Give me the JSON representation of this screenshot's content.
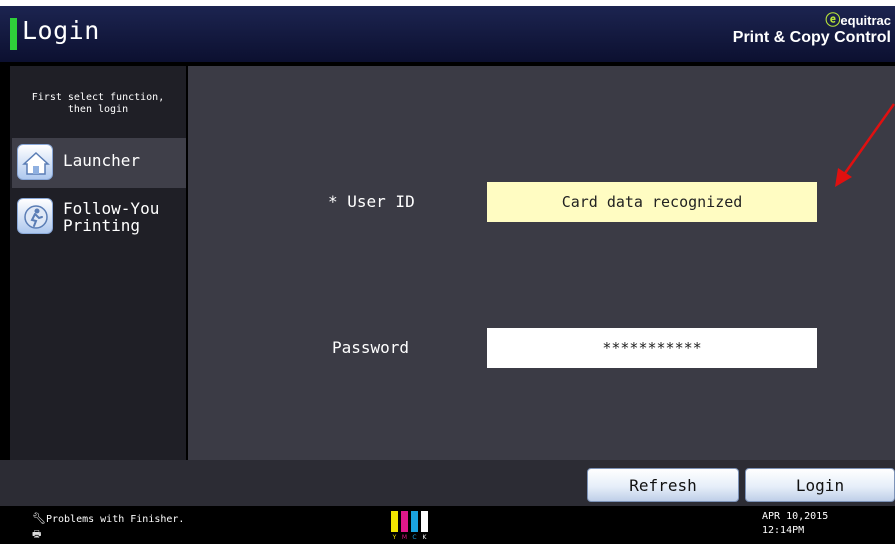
{
  "header": {
    "title": "Login",
    "brand_name": "equitrac",
    "brand_product": "Print & Copy Control"
  },
  "sidebar": {
    "hint_line1": "First select function,",
    "hint_line2": "then login",
    "items": [
      {
        "label": "Launcher",
        "icon": "home-icon",
        "active": true
      },
      {
        "label_line1": "Follow-You",
        "label_line2": "Printing",
        "icon": "follow-you-printing-icon",
        "active": false
      }
    ]
  },
  "form": {
    "userid_label": "* User ID",
    "userid_value": "Card data recognized",
    "password_label": "Password",
    "password_value": "***********"
  },
  "buttons": {
    "refresh": "Refresh",
    "login": "Login"
  },
  "status": {
    "message": "Problems with Finisher.",
    "toner_labels": [
      "Y",
      "M",
      "C",
      "K"
    ],
    "date": "APR  10,2015",
    "time": "12:14PM"
  },
  "colors": {
    "accent_green": "#2fcf3a",
    "userid_highlight": "#fffcc2",
    "annotation_arrow": "#e01010"
  }
}
